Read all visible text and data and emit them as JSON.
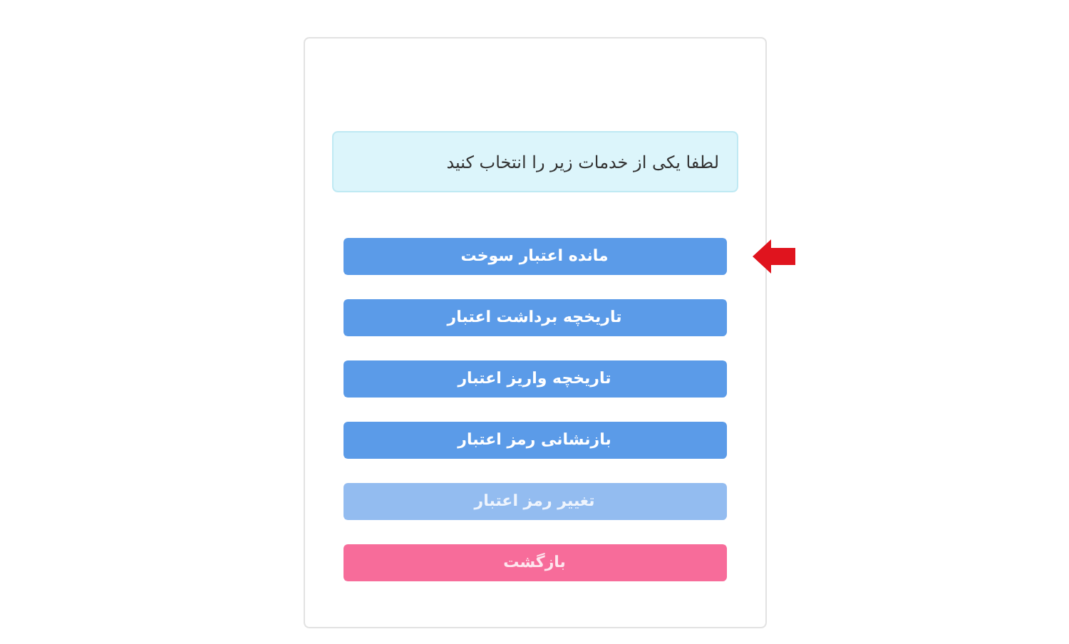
{
  "alert": {
    "text": "لطفا یکی از خدمات زیر را انتخاب کنید"
  },
  "buttons": [
    {
      "label": "مانده اعتبار سوخت",
      "kind": "primary",
      "pointed": true
    },
    {
      "label": "تاریخچه برداشت اعتبار",
      "kind": "primary",
      "pointed": false
    },
    {
      "label": "تاریخچه واریز اعتبار",
      "kind": "primary",
      "pointed": false
    },
    {
      "label": "بازنشانی رمز اعتبار",
      "kind": "primary",
      "pointed": false
    },
    {
      "label": "تغییر رمز اعتبار",
      "kind": "disabled",
      "pointed": false
    },
    {
      "label": "بازگشت",
      "kind": "back",
      "pointed": false
    }
  ]
}
